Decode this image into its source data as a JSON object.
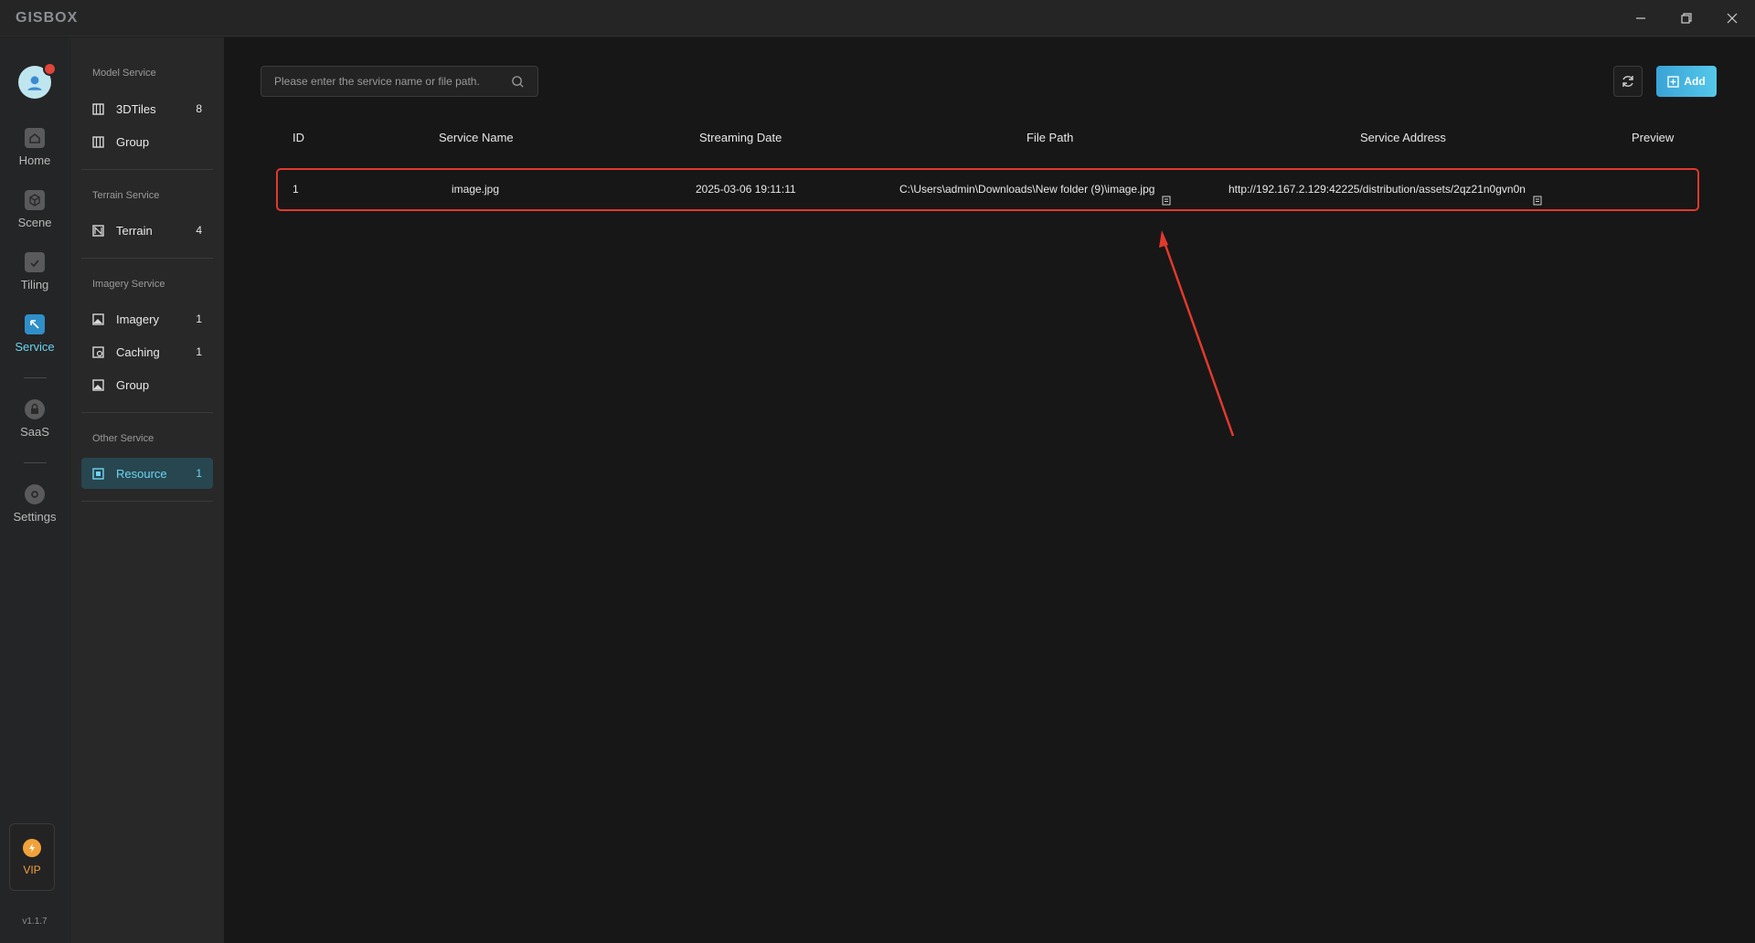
{
  "app": {
    "logo": "GISBOX",
    "version": "v1.1.7"
  },
  "window_controls": [
    "minimize-icon",
    "restore-icon",
    "close-icon"
  ],
  "rail": {
    "items": [
      {
        "label": "Home",
        "icon": "home-icon",
        "active": false
      },
      {
        "label": "Scene",
        "icon": "cube-icon",
        "active": false
      },
      {
        "label": "Tiling",
        "icon": "tiling-icon",
        "active": false
      },
      {
        "label": "Service",
        "icon": "service-icon",
        "active": true
      },
      {
        "label": "SaaS",
        "icon": "lock-icon",
        "active": false
      },
      {
        "label": "Settings",
        "icon": "gear-icon",
        "active": false
      }
    ],
    "vip": {
      "label": "VIP",
      "icon": "bolt-icon"
    }
  },
  "sidebar": {
    "sections": [
      {
        "title": "Model Service",
        "items": [
          {
            "name": "3DTiles",
            "count": "8"
          },
          {
            "name": "Group",
            "count": ""
          }
        ]
      },
      {
        "title": "Terrain Service",
        "items": [
          {
            "name": "Terrain",
            "count": "4"
          }
        ]
      },
      {
        "title": "Imagery Service",
        "items": [
          {
            "name": "Imagery",
            "count": "1"
          },
          {
            "name": "Caching",
            "count": "1"
          },
          {
            "name": "Group",
            "count": ""
          }
        ]
      },
      {
        "title": "Other Service",
        "items": [
          {
            "name": "Resource",
            "count": "1",
            "active": true
          }
        ]
      }
    ]
  },
  "toolbar": {
    "search_placeholder": "Please enter the service name or file path.",
    "add_label": "Add"
  },
  "table": {
    "columns": [
      "ID",
      "Service Name",
      "Streaming Date",
      "File Path",
      "Service Address",
      "Preview"
    ],
    "rows": [
      {
        "id": "1",
        "service_name": "image.jpg",
        "streaming_date": "2025-03-06 19:11:11",
        "file_path": "C:\\Users\\admin\\Downloads\\New folder (9)\\image.jpg",
        "service_address": "http://192.167.2.129:42225/distribution/assets/2qz21n0gvn0n"
      }
    ]
  },
  "colors": {
    "accent": "#54c8ea",
    "highlight": "#e2392d",
    "active_bg": "#27464f"
  }
}
